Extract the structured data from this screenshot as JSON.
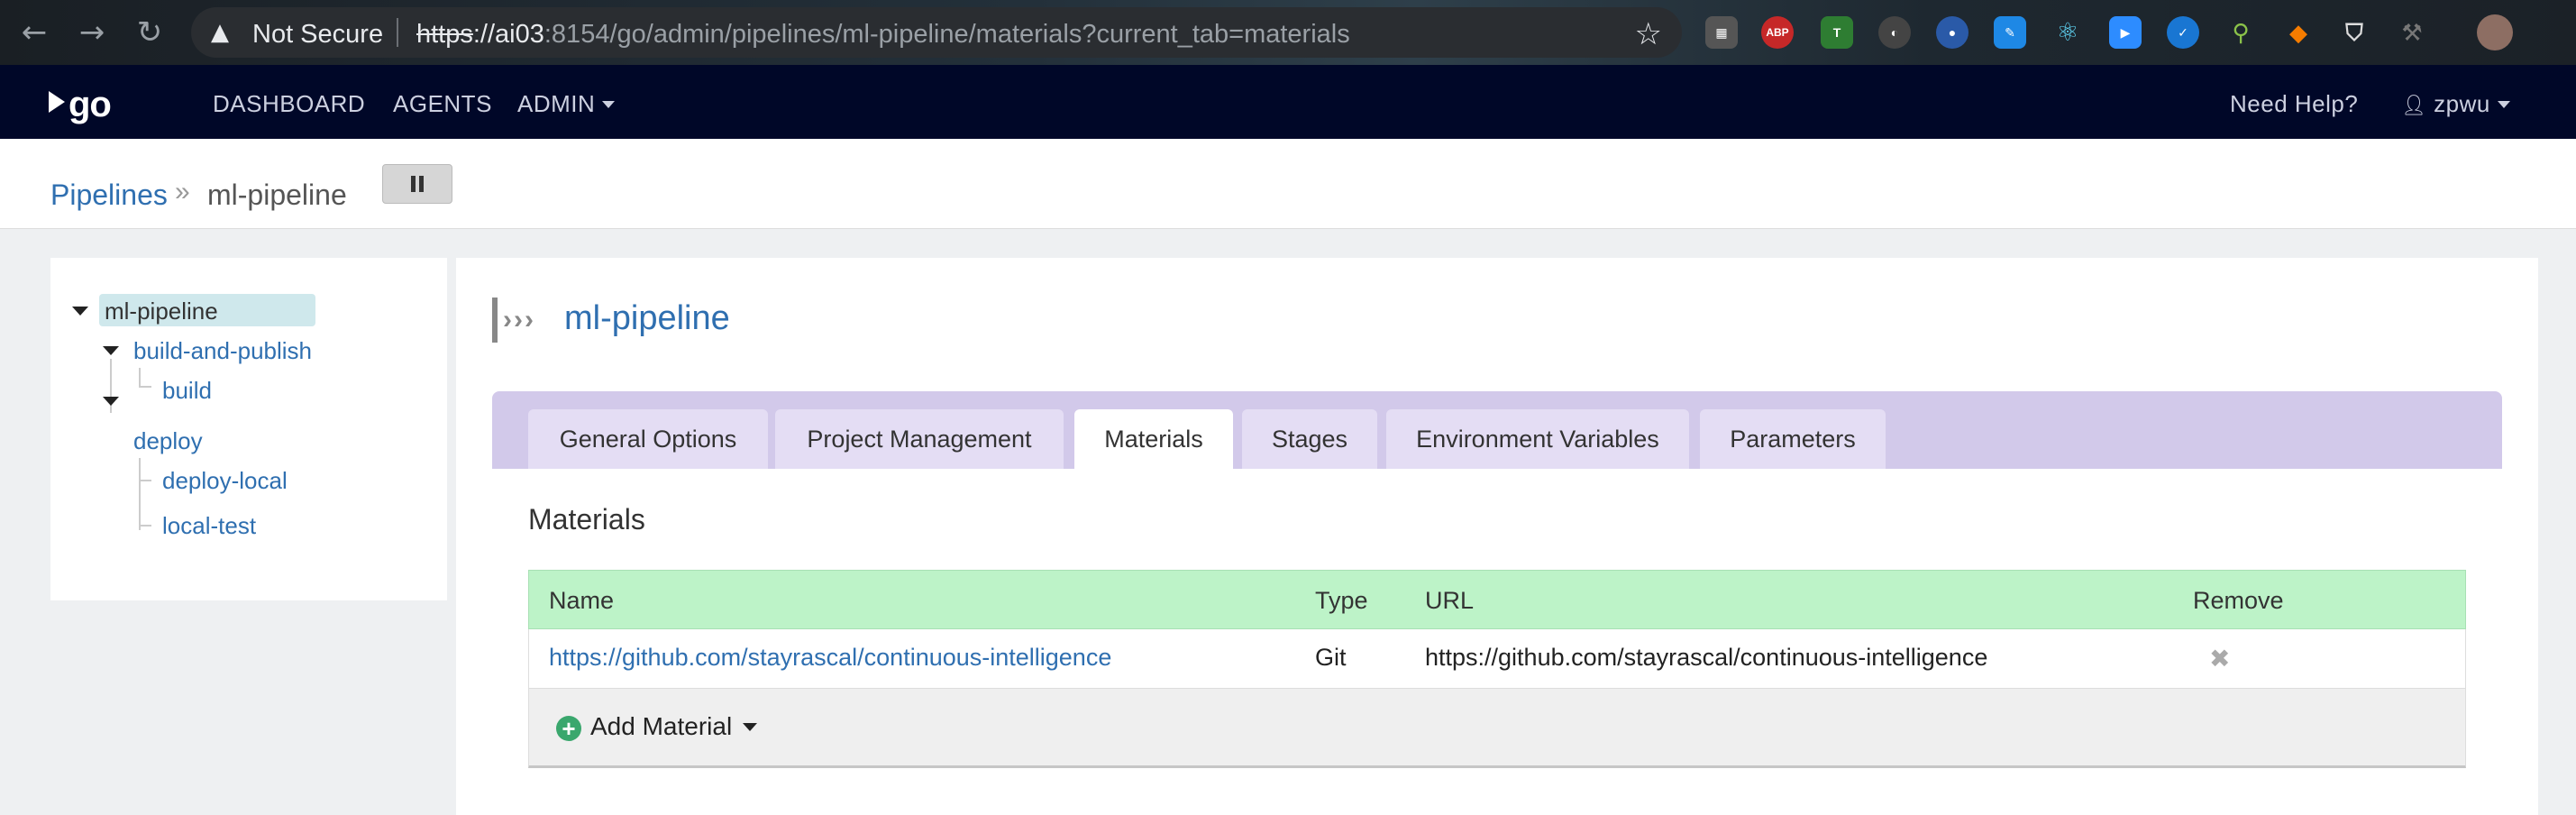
{
  "browser": {
    "security_label": "Not Secure",
    "url_scheme": "https",
    "url_host": "://ai03",
    "url_rest": ":8154/go/admin/pipelines/ml-pipeline/materials?current_tab=materials",
    "extensions": [
      "ABP",
      "T"
    ]
  },
  "header": {
    "logo": "go",
    "nav": [
      "DASHBOARD",
      "AGENTS",
      "ADMIN"
    ],
    "help": "Need Help?",
    "user": "zpwu"
  },
  "breadcrumb": {
    "root": "Pipelines",
    "separator": "»",
    "current": "ml-pipeline"
  },
  "tree": {
    "pipeline": "ml-pipeline",
    "stages": [
      {
        "name": "build-and-publish",
        "jobs": [
          "build"
        ]
      },
      {
        "name": "deploy",
        "jobs": [
          "deploy-local",
          "local-test"
        ]
      }
    ]
  },
  "main": {
    "title": "ml-pipeline",
    "tabs": [
      "General Options",
      "Project Management",
      "Materials",
      "Stages",
      "Environment Variables",
      "Parameters"
    ],
    "active_tab": "Materials",
    "section_title": "Materials",
    "table": {
      "headers": [
        "Name",
        "Type",
        "URL",
        "Remove"
      ],
      "rows": [
        {
          "name": "https://github.com/stayrascal/continuous-intelligence",
          "type": "Git",
          "url": "https://github.com/stayrascal/continuous-intelligence"
        }
      ]
    },
    "add_material": "Add Material"
  },
  "colors": {
    "header_bg": "#000728",
    "link": "#2f6fb0",
    "tab_bar": "#d2c9ea",
    "table_header": "#bdf3c8"
  }
}
